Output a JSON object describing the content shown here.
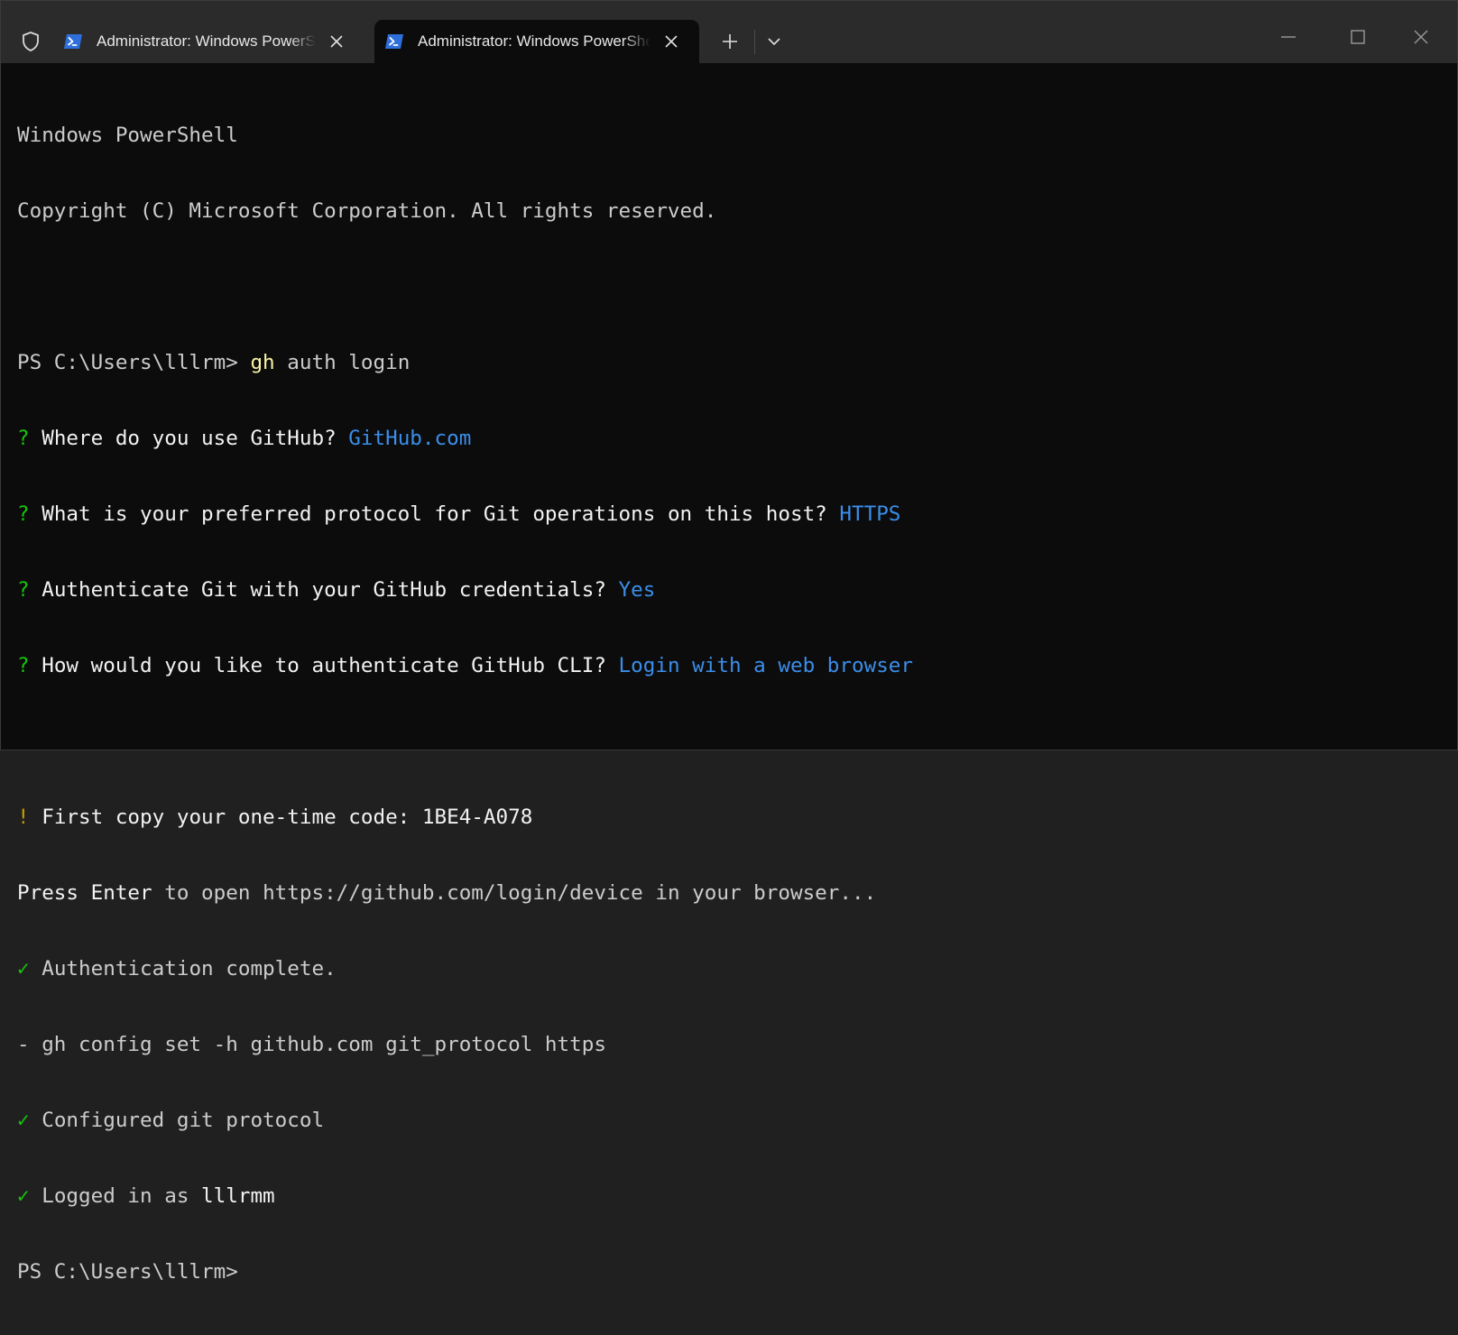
{
  "window": {
    "tabs": [
      {
        "title": "Administrator: Windows PowerShell",
        "active": false
      },
      {
        "title": "Administrator: Windows PowerShell",
        "active": true
      }
    ],
    "icons": {
      "shield": "shield-icon",
      "powershell": "powershell-icon",
      "close_tab": "close-icon",
      "new_tab": "plus-icon",
      "dropdown": "chevron-down-icon",
      "minimize": "minimize-icon",
      "maximize": "maximize-icon",
      "close_window": "close-icon"
    },
    "colors": {
      "titlebar": "#2b2b2b",
      "console_bg": "#0c0c0c",
      "text": "#cccccc",
      "green": "#16c60c",
      "blue": "#3b8eea",
      "yellow": "#f9f1a5",
      "warning": "#c19c00",
      "powershell_icon": "#2f6fdc"
    }
  },
  "console": {
    "header": [
      "Windows PowerShell",
      "Copyright (C) Microsoft Corporation. All rights reserved."
    ],
    "prompt1": {
      "prompt": "PS C:\\Users\\lllrm> ",
      "cmd": "gh",
      "args": " auth login"
    },
    "questions": [
      {
        "mark": "?",
        "text": " Where do you use GitHub? ",
        "answer": "GitHub.com"
      },
      {
        "mark": "?",
        "text": " What is your preferred protocol for Git operations on this host? ",
        "answer": "HTTPS"
      },
      {
        "mark": "?",
        "text": " Authenticate Git with your GitHub credentials? ",
        "answer": "Yes"
      },
      {
        "mark": "?",
        "text": " How would you like to authenticate GitHub CLI? ",
        "answer": "Login with a web browser"
      }
    ],
    "code_line": {
      "mark": "!",
      "text": " First copy your one-time code: ",
      "code": "1BE4-A078"
    },
    "enter_line": {
      "bold": "Press Enter",
      "rest": " to open https://github.com/login/device in your browser..."
    },
    "auth_complete": {
      "mark": "✓",
      "text": " Authentication complete."
    },
    "config_cmd": "- gh config set -h github.com git_protocol https",
    "configured": {
      "mark": "✓",
      "text": " Configured git protocol"
    },
    "logged_in": {
      "mark": "✓",
      "text": " Logged in as ",
      "user": "lllrmm"
    },
    "prompt2": "PS C:\\Users\\lllrm>"
  }
}
